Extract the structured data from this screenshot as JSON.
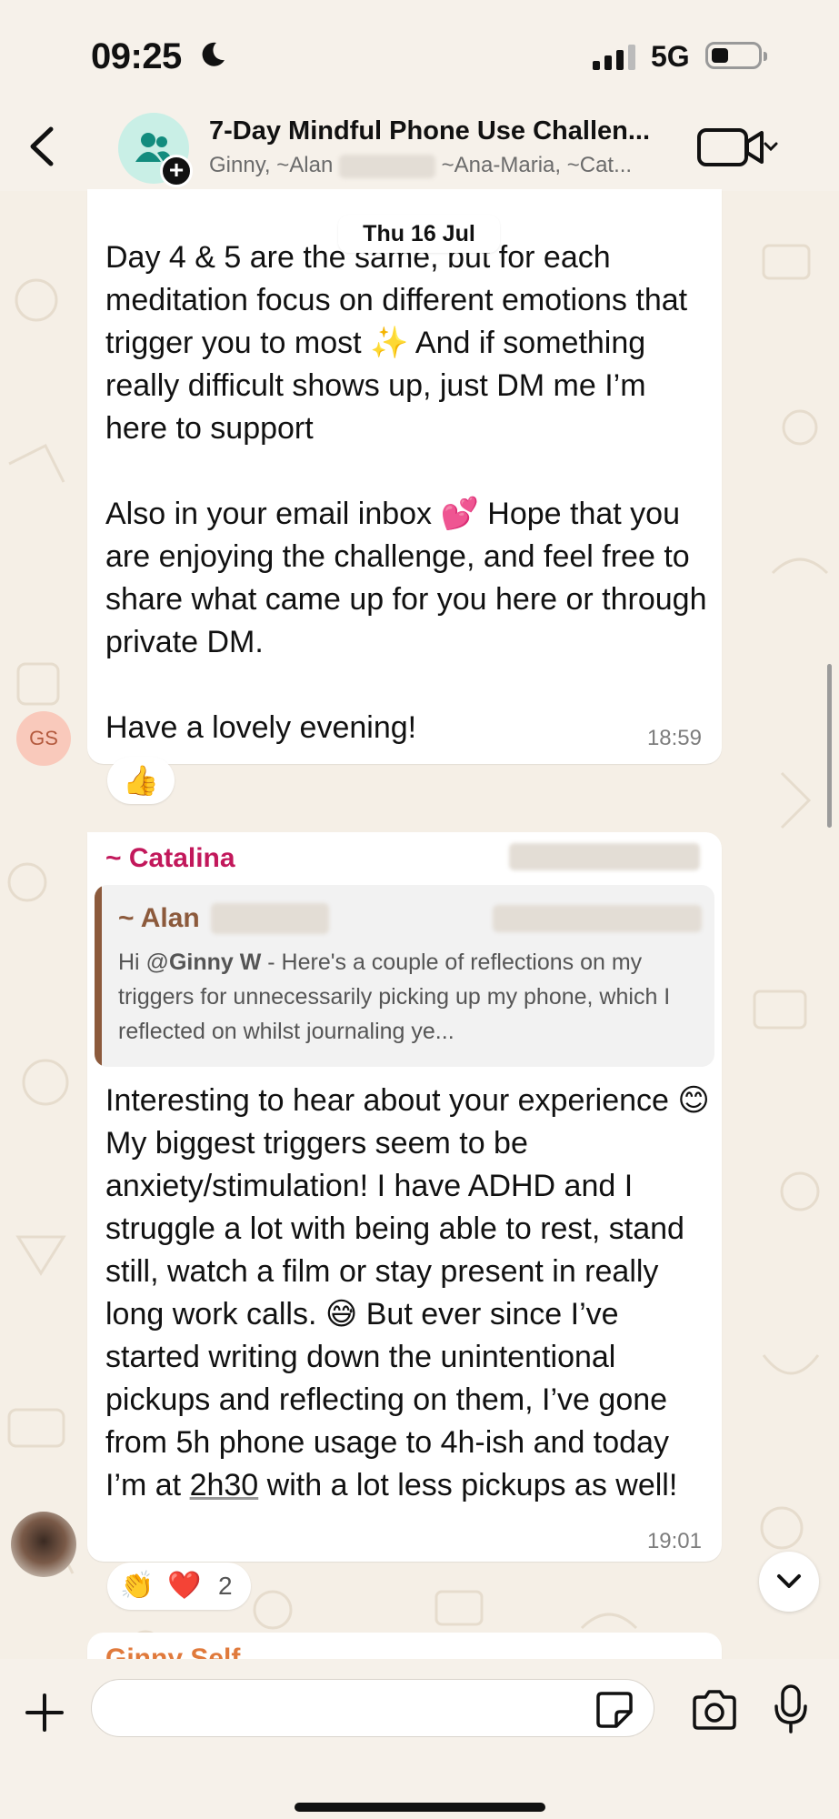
{
  "status_bar": {
    "time": "09:25",
    "network": "5G"
  },
  "header": {
    "title": "7-Day Mindful Phone Use Challen...",
    "subtitle_start": "Ginny, ~Alan",
    "subtitle_end": "~Ana-Maria, ~Cat..."
  },
  "date_pill": "Thu 16 Jul",
  "messages": [
    {
      "avatar_initials": "GS",
      "text": "Day 4 & 5 are the same, but for each meditation focus on different emotions that trigger you to most ✨ And if something really difficult shows up, just DM me I’m here to support\n\nAlso in your email inbox 💕 Hope that you are enjoying the challenge, and feel free to share what came up for you here or through private DM.\n\nHave a lovely evening!",
      "time": "18:59",
      "reactions": "👍"
    },
    {
      "sender": "~ Catalina",
      "quote": {
        "name": "~ Alan",
        "text_prefix": "Hi @",
        "mention": "Ginny W",
        "text_rest": "  - Here's a couple of reflections on my triggers for unnecessarily picking up my phone, which I reflected on whilst journaling ye..."
      },
      "text_before": "Interesting to hear about your experience 😊 My biggest triggers seem to be anxiety/stimulation! I have ADHD and I struggle a lot with being able to rest, stand still, watch a film or stay present in really long work calls. 😅 But ever since I’ve started writing down the unintentional pickups and reflecting on them, I’ve gone from 5h phone usage to 4h-ish and today I’m at ",
      "text_link": "2h30",
      "text_after": " with a lot less pickups as well!",
      "time": "19:01",
      "reactions": {
        "emoji_1": "👏",
        "emoji_2": "❤️",
        "count": "2"
      }
    },
    {
      "sender": "Ginny Self"
    }
  ],
  "composer": {
    "placeholder": ""
  },
  "icons": [
    "back-chevron-icon",
    "group-icon",
    "plus-badge-icon",
    "video-call-icon",
    "chevron-down-icon",
    "plus-icon",
    "sticker-icon",
    "camera-icon",
    "microphone-icon"
  ]
}
